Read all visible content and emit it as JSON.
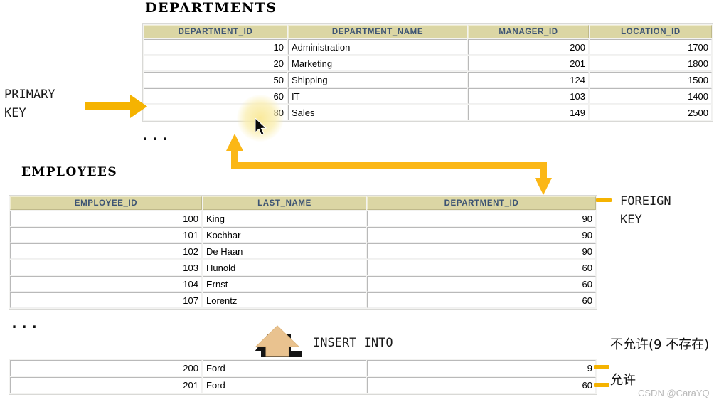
{
  "departments": {
    "title": "DEPARTMENTS",
    "columns": [
      "DEPARTMENT_ID",
      "DEPARTMENT_NAME",
      "MANAGER_ID",
      "LOCATION_ID"
    ],
    "rows": [
      [
        "10",
        "Administration",
        "200",
        "1700"
      ],
      [
        "20",
        "Marketing",
        "201",
        "1800"
      ],
      [
        "50",
        "Shipping",
        "124",
        "1500"
      ],
      [
        "60",
        "IT",
        "103",
        "1400"
      ],
      [
        "80",
        "Sales",
        "149",
        "2500"
      ]
    ],
    "ellipsis": "..."
  },
  "employees": {
    "title": "EMPLOYEES",
    "columns": [
      "EMPLOYEE_ID",
      "LAST_NAME",
      "DEPARTMENT_ID"
    ],
    "rows": [
      [
        "100",
        "King",
        "90"
      ],
      [
        "101",
        "Kochhar",
        "90"
      ],
      [
        "102",
        "De Haan",
        "90"
      ],
      [
        "103",
        "Hunold",
        "60"
      ],
      [
        "104",
        "Ernst",
        "60"
      ],
      [
        "107",
        "Lorentz",
        "60"
      ]
    ],
    "ellipsis": "..."
  },
  "insert_rows": {
    "rows": [
      [
        "200",
        "Ford",
        "9"
      ],
      [
        "201",
        "Ford",
        "60"
      ]
    ]
  },
  "annotations": {
    "primary_key": "PRIMARY\nKEY",
    "foreign_key": "FOREIGN\nKEY",
    "insert_into": "INSERT INTO",
    "not_allowed": "不允许(9 不存在)",
    "allowed": "允许"
  },
  "watermark": "CSDN @CaraYQ",
  "colors": {
    "header_bg": "#dbd6a4",
    "header_text": "#3d5473",
    "arrow_gold": "#f5b301",
    "insert_arrow": "#e9c28f"
  }
}
